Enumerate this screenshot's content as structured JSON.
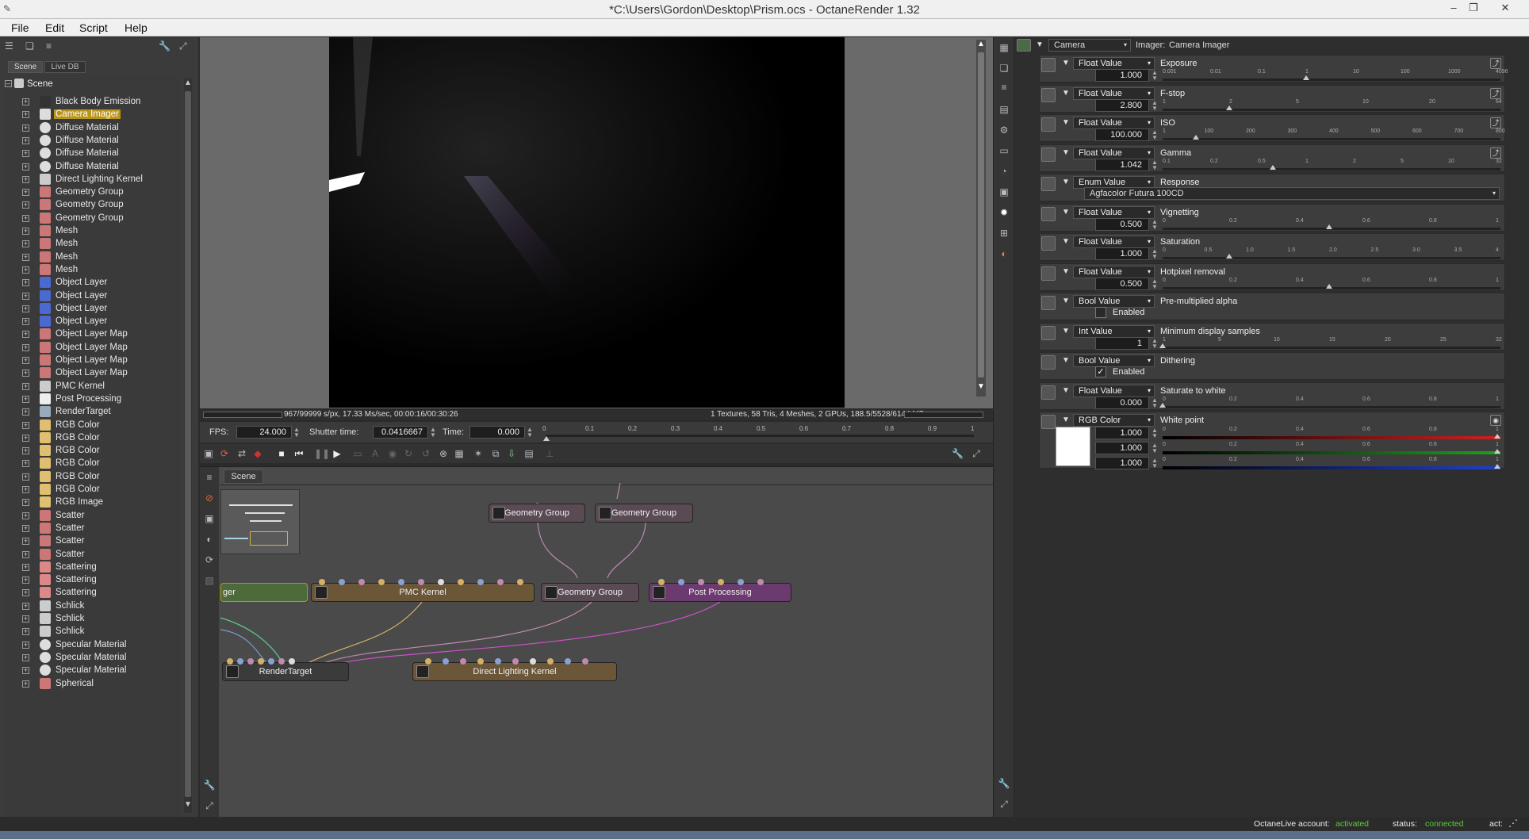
{
  "window": {
    "title": "*C:\\Users\\Gordon\\Desktop\\Prism.ocs - OctaneRender 1.32"
  },
  "menu": [
    "File",
    "Edit",
    "Script",
    "Help"
  ],
  "scene_panel": {
    "tabs": [
      "Scene",
      "Live DB"
    ],
    "root": "Scene",
    "items": [
      {
        "label": "Black Body Emission",
        "icon": "emission-icon"
      },
      {
        "label": "Camera Imager",
        "icon": "imager-icon",
        "selected": true
      },
      {
        "label": "Diffuse Material",
        "icon": "material-sphere-icon"
      },
      {
        "label": "Diffuse Material",
        "icon": "material-sphere-icon"
      },
      {
        "label": "Diffuse Material",
        "icon": "material-sphere-icon"
      },
      {
        "label": "Diffuse Material",
        "icon": "material-sphere-icon"
      },
      {
        "label": "Direct Lighting Kernel",
        "icon": "kernel-icon"
      },
      {
        "label": "Geometry Group",
        "icon": "geometry-group-icon"
      },
      {
        "label": "Geometry Group",
        "icon": "geometry-group-icon"
      },
      {
        "label": "Geometry Group",
        "icon": "geometry-group-icon"
      },
      {
        "label": "Mesh",
        "icon": "mesh-icon"
      },
      {
        "label": "Mesh",
        "icon": "mesh-icon"
      },
      {
        "label": "Mesh",
        "icon": "mesh-icon"
      },
      {
        "label": "Mesh",
        "icon": "mesh-icon"
      },
      {
        "label": "Object Layer",
        "icon": "object-layer-icon"
      },
      {
        "label": "Object Layer",
        "icon": "object-layer-icon"
      },
      {
        "label": "Object Layer",
        "icon": "object-layer-icon"
      },
      {
        "label": "Object Layer",
        "icon": "object-layer-icon"
      },
      {
        "label": "Object Layer Map",
        "icon": "mesh-icon"
      },
      {
        "label": "Object Layer Map",
        "icon": "mesh-icon"
      },
      {
        "label": "Object Layer Map",
        "icon": "mesh-icon"
      },
      {
        "label": "Object Layer Map",
        "icon": "mesh-icon"
      },
      {
        "label": "PMC Kernel",
        "icon": "kernel-icon"
      },
      {
        "label": "Post Processing",
        "icon": "post-processing-icon"
      },
      {
        "label": "RenderTarget",
        "icon": "render-target-icon"
      },
      {
        "label": "RGB Color",
        "icon": "rgb-color-icon"
      },
      {
        "label": "RGB Color",
        "icon": "rgb-color-icon"
      },
      {
        "label": "RGB Color",
        "icon": "rgb-color-icon"
      },
      {
        "label": "RGB Color",
        "icon": "rgb-color-icon"
      },
      {
        "label": "RGB Color",
        "icon": "rgb-color-icon"
      },
      {
        "label": "RGB Color",
        "icon": "rgb-color-icon"
      },
      {
        "label": "RGB Image",
        "icon": "rgb-image-icon"
      },
      {
        "label": "Scatter",
        "icon": "scatter-icon"
      },
      {
        "label": "Scatter",
        "icon": "scatter-icon"
      },
      {
        "label": "Scatter",
        "icon": "scatter-icon"
      },
      {
        "label": "Scatter",
        "icon": "scatter-icon"
      },
      {
        "label": "Scattering",
        "icon": "scattering-icon"
      },
      {
        "label": "Scattering",
        "icon": "scattering-icon"
      },
      {
        "label": "Scattering",
        "icon": "scattering-icon"
      },
      {
        "label": "Schlick",
        "icon": "schlick-icon"
      },
      {
        "label": "Schlick",
        "icon": "schlick-icon"
      },
      {
        "label": "Schlick",
        "icon": "schlick-icon"
      },
      {
        "label": "Specular Material",
        "icon": "material-sphere-icon"
      },
      {
        "label": "Specular Material",
        "icon": "material-sphere-icon"
      },
      {
        "label": "Specular Material",
        "icon": "material-sphere-icon"
      },
      {
        "label": "Spherical",
        "icon": "mesh-icon"
      }
    ]
  },
  "render_status": {
    "left": "967/99999 s/px, 17.33 Ms/sec, 00:00:16/00:30:26",
    "right": "1 Textures, 58 Tris, 4 Meshes, 2 GPUs, 188.5/5528/6144 MB"
  },
  "timeline": {
    "fps_label": "FPS:",
    "fps_value": "24.000",
    "shutter_label": "Shutter time:",
    "shutter_value": "0.0416667",
    "time_label": "Time:",
    "time_value": "0.000",
    "ticks": [
      "0",
      "0.1",
      "0.2",
      "0.3",
      "0.4",
      "0.5",
      "0.6",
      "0.7",
      "0.8",
      "0.9",
      "1"
    ]
  },
  "graph": {
    "tab": "Scene",
    "nodes": {
      "geo1": "Geometry Group",
      "geo2": "Geometry Group",
      "geo3": "Geometry Group",
      "imager": "ger",
      "pmc": "PMC Kernel",
      "post": "Post Processing",
      "rt": "RenderTarget",
      "dlk": "Direct Lighting Kernel"
    }
  },
  "inspector": {
    "type": "Camera",
    "imager_label": "Imager:",
    "imager_value": "Camera Imager",
    "params": [
      {
        "type": "Float Value",
        "name": "Exposure",
        "value": "1.000",
        "ticks": [
          "0.001",
          "0.01",
          "0.1",
          "1",
          "10",
          "100",
          "1000",
          "4096"
        ],
        "pos": 0.43
      },
      {
        "type": "Float Value",
        "name": "F-stop",
        "value": "2.800",
        "ticks": [
          "1",
          "2",
          "5",
          "10",
          "20",
          "64"
        ],
        "pos": 0.2
      },
      {
        "type": "Float Value",
        "name": "ISO",
        "value": "100.000",
        "ticks": [
          "1",
          "100",
          "200",
          "300",
          "400",
          "500",
          "600",
          "700",
          "800"
        ],
        "pos": 0.1
      },
      {
        "type": "Float Value",
        "name": "Gamma",
        "value": "1.042",
        "ticks": [
          "0.1",
          "0.2",
          "0.5",
          "1",
          "2",
          "5",
          "10",
          "32"
        ],
        "pos": 0.33
      },
      {
        "type": "Enum Value",
        "name": "Response",
        "enum": "Agfacolor Futura 100CD"
      },
      {
        "type": "Float Value",
        "name": "Vignetting",
        "value": "0.500",
        "ticks": [
          "0",
          "0.2",
          "0.4",
          "0.6",
          "0.8",
          "1"
        ],
        "pos": 0.5
      },
      {
        "type": "Float Value",
        "name": "Saturation",
        "value": "1.000",
        "ticks": [
          "0",
          "0.5",
          "1.0",
          "1.5",
          "2.0",
          "2.5",
          "3.0",
          "3.5",
          "4"
        ],
        "pos": 0.2
      },
      {
        "type": "Float Value",
        "name": "Hotpixel removal",
        "value": "0.500",
        "ticks": [
          "0",
          "0.2",
          "0.4",
          "0.6",
          "0.8",
          "1"
        ],
        "pos": 0.5
      },
      {
        "type": "Bool Value",
        "name": "Pre-multiplied alpha",
        "checked": false,
        "check_label": "Enabled"
      },
      {
        "type": "Int Value",
        "name": "Minimum display samples",
        "value": "1",
        "ticks": [
          "1",
          "5",
          "10",
          "15",
          "20",
          "25",
          "32"
        ],
        "pos": 0.0
      },
      {
        "type": "Bool Value",
        "name": "Dithering",
        "checked": true,
        "check_label": "Enabled"
      },
      {
        "type": "Float Value",
        "name": "Saturate to white",
        "value": "0.000",
        "ticks": [
          "0",
          "0.2",
          "0.4",
          "0.6",
          "0.8",
          "1"
        ],
        "pos": 0.0
      },
      {
        "type": "RGB Color",
        "name": "White point",
        "rgb": [
          "1.000",
          "1.000",
          "1.000"
        ],
        "ticks": [
          "0",
          "0.2",
          "0.4",
          "0.6",
          "0.8",
          "1"
        ]
      }
    ]
  },
  "footer": {
    "account_label": "OctaneLive account:",
    "account_value": "activated",
    "status_label": "status:",
    "status_value": "connected",
    "act_label": "act:"
  },
  "colors": {
    "selected": "#b8941a",
    "active_green": "#5ccc3c",
    "node_kernel": "#6b5638",
    "node_geo": "#5a4a54",
    "node_post": "#6b3a6e",
    "node_rt": "#3b3b3b"
  }
}
